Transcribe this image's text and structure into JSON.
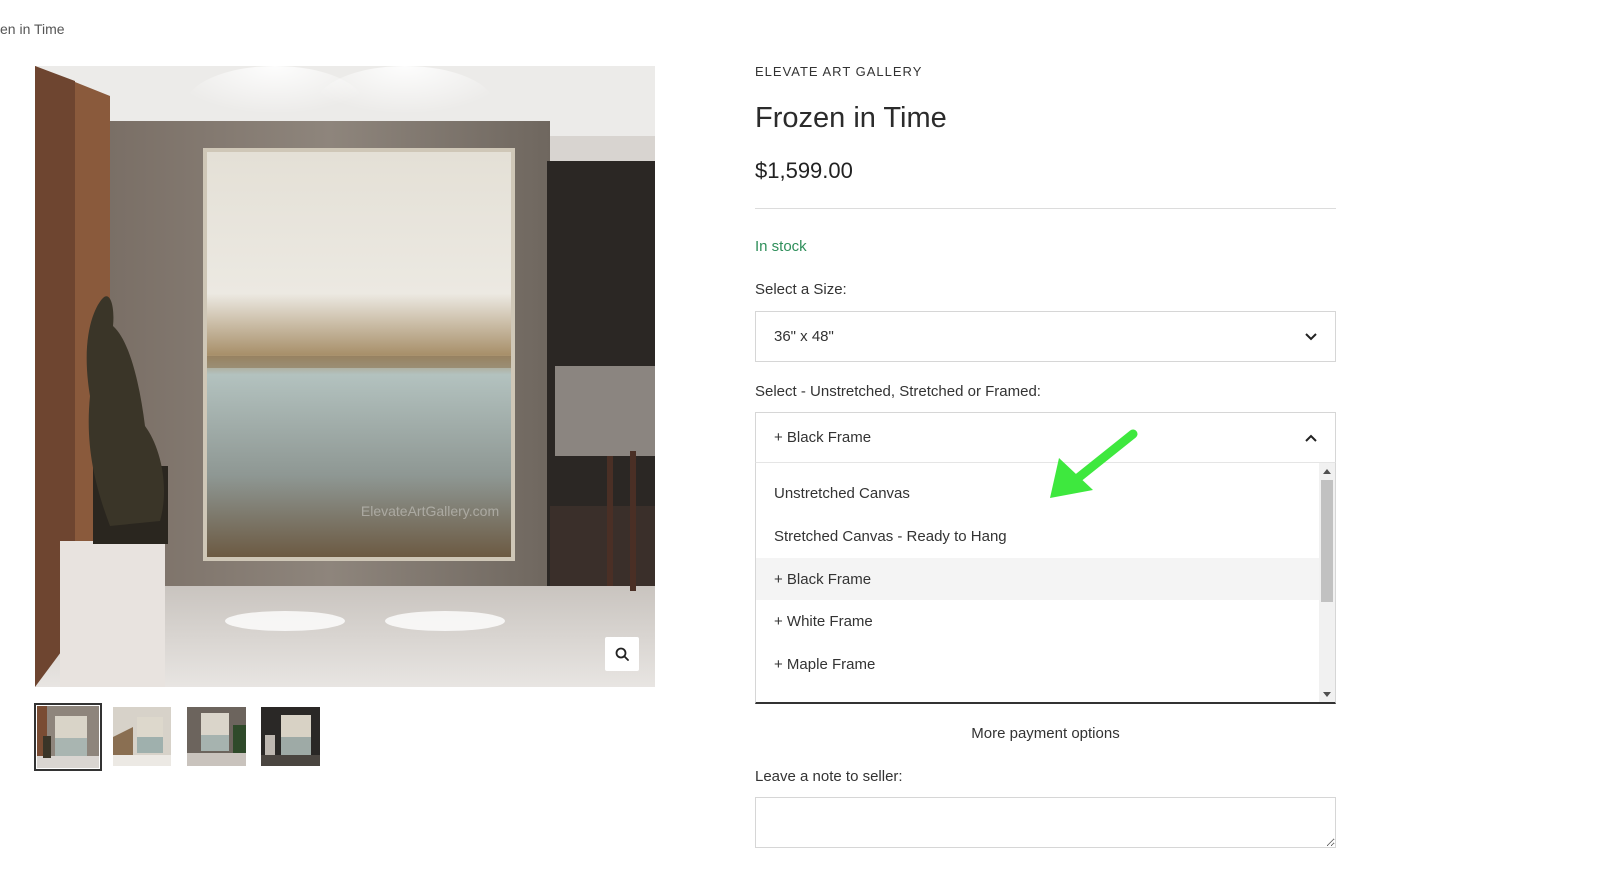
{
  "breadcrumb": {
    "current": "en in Time"
  },
  "product": {
    "vendor": "ELEVATE ART GALLERY",
    "title": "Frozen in Time",
    "price": "$1,599.00",
    "stock_status": "In stock",
    "image_watermark": "ElevateArtGallery.com"
  },
  "size_select": {
    "label": "Select a Size:",
    "value": "36\" x 48\""
  },
  "frame_select": {
    "label": "Select - Unstretched, Stretched or Framed:",
    "value": "+ Black Frame",
    "options": [
      "Unstretched Canvas",
      "Stretched Canvas - Ready to Hang",
      "+ Black Frame",
      "+ White Frame",
      "+ Maple Frame"
    ],
    "selected_index": 2
  },
  "payment": {
    "more_options": "More payment options"
  },
  "note": {
    "label": "Leave a note to seller:",
    "value": ""
  },
  "icons": {
    "zoom": "magnifier-icon",
    "size_chevron": "chevron-down-icon",
    "frame_chevron": "chevron-up-icon",
    "annotation": "green-arrow-icon"
  },
  "colors": {
    "stock": "#2f8f5b",
    "annotation_arrow": "#3ee83e"
  }
}
